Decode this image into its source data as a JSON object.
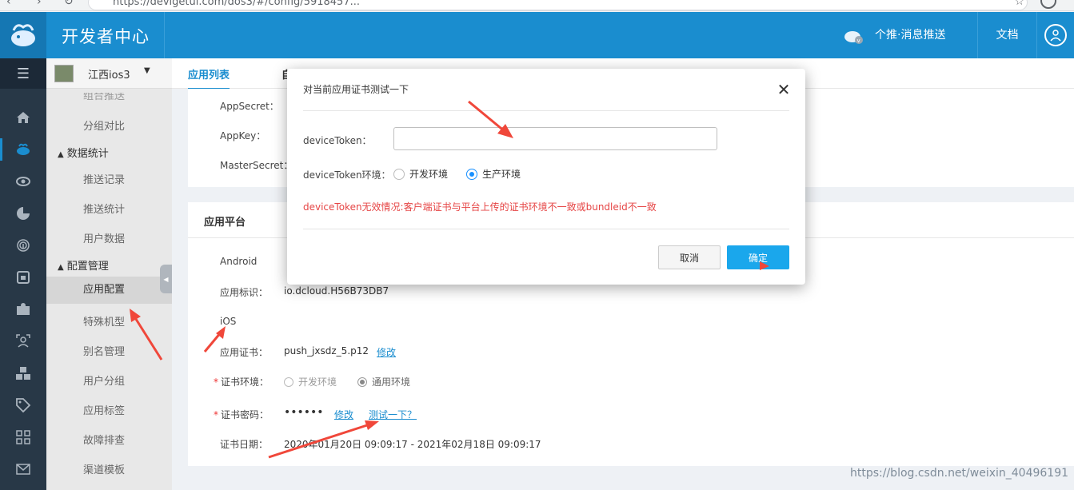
{
  "browser": {
    "url": "https://devigetui.com/dos3/#/config/5918457..."
  },
  "header": {
    "app_title": "开发者中心",
    "product_label": "个推·消息推送",
    "docs_label": "文档"
  },
  "app_selector": {
    "name": "江西ios3",
    "caret": "▼"
  },
  "sub_menu": {
    "partial_top": "组合推送",
    "items_group1": [
      {
        "label": "分组对比"
      }
    ],
    "group_data": "数据统计",
    "items_data": [
      {
        "label": "推送记录"
      },
      {
        "label": "推送统计"
      },
      {
        "label": "用户数据"
      }
    ],
    "group_config": "配置管理",
    "items_config": [
      {
        "label": "应用配置"
      },
      {
        "label": "特殊机型"
      },
      {
        "label": "别名管理"
      },
      {
        "label": "用户分组"
      },
      {
        "label": "应用标签"
      },
      {
        "label": "故障排查"
      },
      {
        "label": "渠道模板"
      }
    ]
  },
  "tabs": {
    "tab1": "应用列表",
    "tab2": "自"
  },
  "top_card": {
    "app_secret_label": "AppSecret：",
    "app_key_label": "AppKey：",
    "master_secret_label": "MasterSecret："
  },
  "platform_card": {
    "title": "应用平台",
    "android_label": "Android",
    "app_id_label": "应用标识：",
    "app_id_value": "io.dcloud.H56B73DB7",
    "ios_label": "iOS",
    "cert_label": "应用证书：",
    "cert_value": "push_jxsdz_5.p12",
    "cert_edit": "修改",
    "env_label": "证书环境：",
    "env_dev": "开发环境",
    "env_general": "通用环境",
    "pwd_label": "证书密码：",
    "pwd_value": "••••••",
    "pwd_edit": "修改",
    "pwd_test": "测试一下？",
    "date_label": "证书日期：",
    "date_value": "2020年01月20日 09:09:17 - 2021年02月18日 09:09:17"
  },
  "modal": {
    "title": "对当前应用证书测试一下",
    "device_token_label": "deviceToken：",
    "device_token_value": "",
    "env_label": "deviceToken环境：",
    "env_dev": "开发环境",
    "env_prod": "生产环境",
    "env_selected": "生产环境",
    "warning": "deviceToken无效情况:客户端证书与平台上传的证书环境不一致或bundleid不一致",
    "cancel_label": "取消",
    "ok_label": "确定"
  },
  "watermark": "https://blog.csdn.net/weixin_40496191",
  "colors": {
    "header_bg": "#1a8dcf",
    "rail_bg": "#283847",
    "primary_button": "#1aa7ec",
    "warning_text": "#e64545",
    "annotation_arrow": "#f0473a"
  }
}
